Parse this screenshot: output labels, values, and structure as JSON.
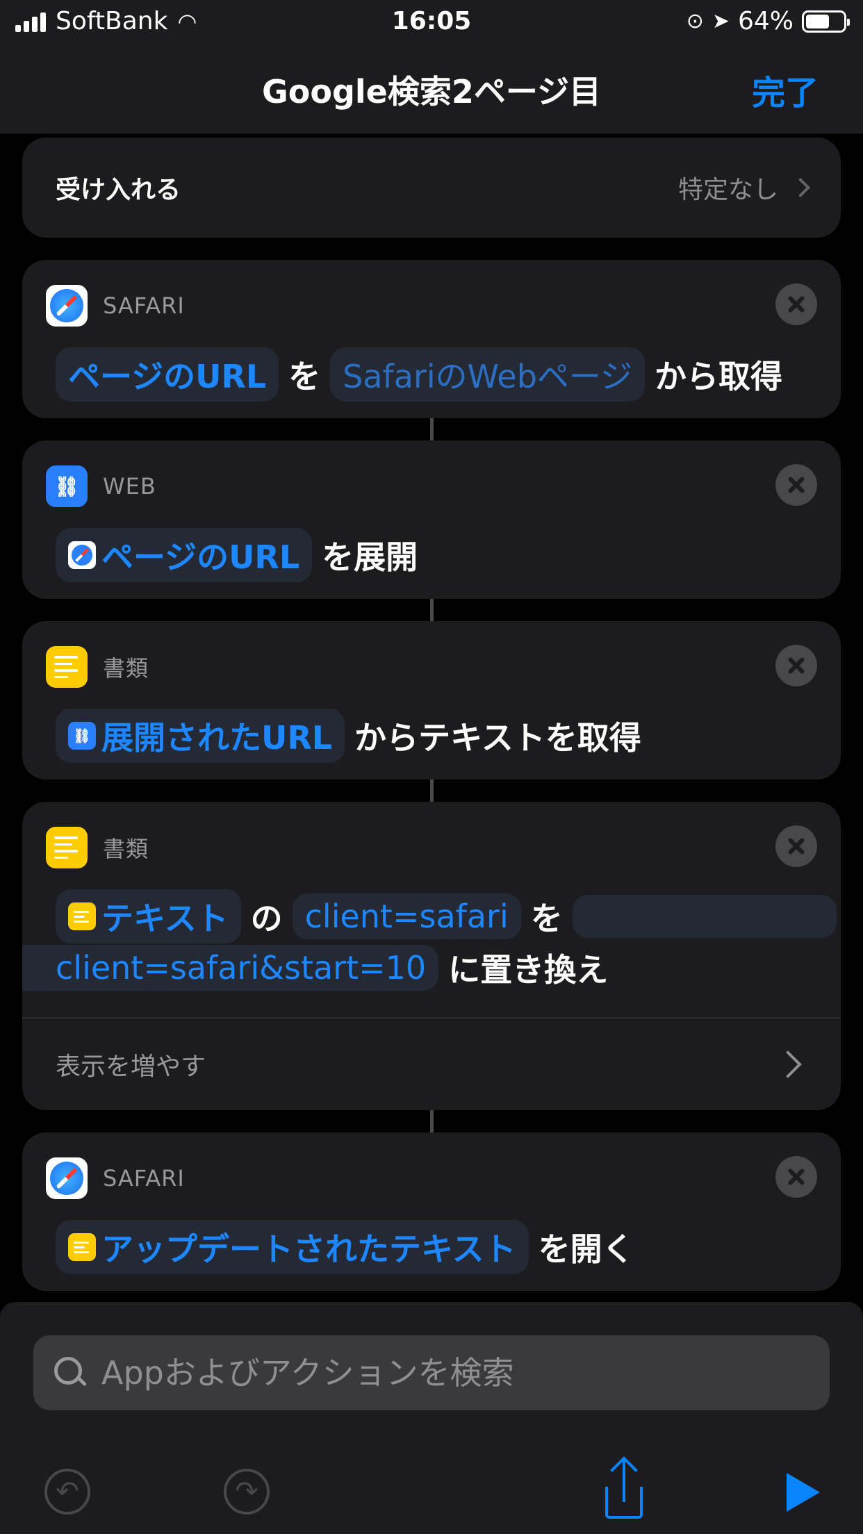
{
  "status_bar": {
    "carrier": "SoftBank",
    "time": "16:05",
    "battery_percent": "64%",
    "battery_level": 0.64
  },
  "nav": {
    "title": "Google検索2ページ目",
    "done_label": "完了"
  },
  "accept": {
    "label": "受け入れる",
    "value": "特定なし"
  },
  "actions": [
    {
      "category": "SAFARI",
      "icon": "safari-icon",
      "parts": {
        "token1": "ページのURL",
        "word1": "を",
        "token2": "SafariのWebページ",
        "word2": "から取得"
      }
    },
    {
      "category": "WEB",
      "icon": "link-icon",
      "parts": {
        "token1": "ページのURL",
        "word1": "を展開"
      }
    },
    {
      "category": "書類",
      "icon": "document-icon",
      "parts": {
        "token1": "展開されたURL",
        "word1": "からテキストを取得"
      }
    },
    {
      "category": "書類",
      "icon": "document-icon",
      "parts": {
        "token1": "テキスト",
        "word1": "の",
        "token2": "client=safari",
        "word2": "を",
        "token3": "client=safari&start=10",
        "word3": "に置き換え"
      },
      "show_more": "表示を増やす"
    },
    {
      "category": "SAFARI",
      "icon": "safari-icon",
      "parts": {
        "token1": "アップデートされたテキスト",
        "word1": "を開く"
      }
    }
  ],
  "search": {
    "placeholder": "Appおよびアクションを検索"
  },
  "colors": {
    "accent": "#0a84ff",
    "card": "#1c1c1e",
    "doc_yellow": "#ffcc00"
  }
}
